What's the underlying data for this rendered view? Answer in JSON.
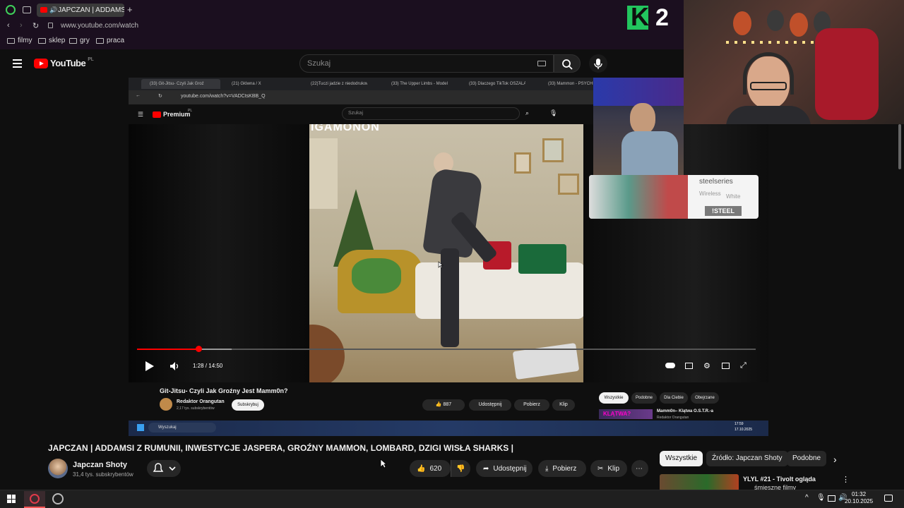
{
  "browser": {
    "active_tab_label": "JAPCZAN | ADDAMSI",
    "url": "www.youtube.com/watch",
    "bookmarks": [
      "filmy",
      "sklep",
      "gry",
      "praca"
    ]
  },
  "youtube": {
    "logo_text": "YouTube",
    "logo_region": "PL",
    "search_placeholder": "Szukaj"
  },
  "overlay": {
    "logo_letter": "K",
    "logo_number": "2"
  },
  "nested": {
    "tabs": [
      "(33) Git-Jitsu- Czyli Jak Groź",
      "(21) Główna / X",
      "(22)Tuczi jadzie z niedodrukow",
      "(33) The Upper Limbs - Model",
      "(33) Dlaczego TikTok OSZALAŁ",
      "(33) Mammon - PSYCHIA"
    ],
    "url": "youtube.com/watch?v=VADCtsKBB_Q",
    "yt_logo": "Premium",
    "yt_region": "PL",
    "search_placeholder": "Szukaj",
    "video_caption": "IGAMONON",
    "time": "1:28 / 14:50",
    "title": "Git-Jitsu- Czyli Jak Groźny Jest Mamm0n?",
    "channel": "Redaktor Orangutan",
    "subs": "2,17 tys. subskrybentów",
    "subscribe": "Subskrybuj",
    "likes": "887",
    "share": "Udostępnij",
    "download": "Pobierz",
    "clip": "Klip",
    "chips": [
      "Wszystkie",
      "Podobne",
      "Dla Ciebie",
      "Obejrzane"
    ],
    "rec_thumb_text": "KLĄTWA?",
    "rec_title": "Mamm0n– Klątwa O.S.T.R.-a",
    "rec_channel": "Redaktor Orangutan",
    "taskbar_search": "Wyszukaj",
    "taskbar_time": "17:59",
    "taskbar_date": "17.10.2025"
  },
  "ad": {
    "brand": "steelseries",
    "line1": "Wireless",
    "line2": "White",
    "code": "!STEEL"
  },
  "video": {
    "title": "JAPCZAN | ADDAMSI Z RUMUNII, INWESTYCJE JASPERA, GROŹNY MAMMON, LOMBARD, DZIGI WISŁA SHARKS |",
    "channel": "Japczan Shoty",
    "subs": "31,4 tys. subskrybentów",
    "likes": "620",
    "share": "Udostępnij",
    "download": "Pobierz",
    "clip": "Klip"
  },
  "sidebar": {
    "chips": [
      "Wszystkie",
      "Źródło: Japczan Shoty",
      "Podobne"
    ],
    "rec_title": "YLYL #21 - Tivolt ogląda",
    "rec_sub": "śmieszne filmy"
  },
  "taskbar": {
    "time": "01:32",
    "date": "20.10.2025"
  },
  "colors": {
    "yt_red": "#ff0000",
    "background": "#0f0f0f",
    "overlay_green": "#22c55e"
  }
}
